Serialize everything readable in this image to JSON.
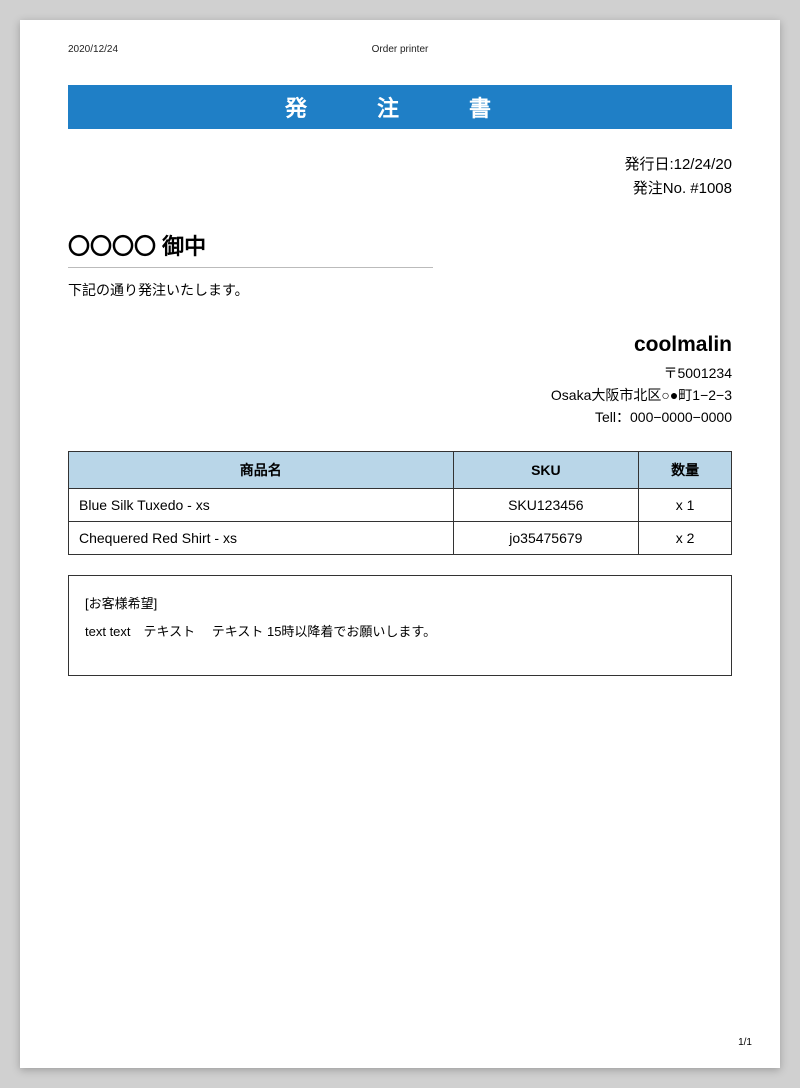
{
  "header": {
    "date_left": "2020/12/24",
    "center": "Order printer"
  },
  "title": "発　注　書",
  "issue": {
    "date_label": "発行日:",
    "date": "12/24/20",
    "no_label": "発注No. ",
    "no": "#1008"
  },
  "recipient": "〇〇〇〇 御中",
  "order_note": "下記の通り発注いたします。",
  "sender": {
    "name": "coolmalin",
    "zip": "〒5001234",
    "address": "Osaka大阪市北区○●町1−2−3",
    "tel": "Tell：000−0000−0000"
  },
  "table": {
    "headers": {
      "name": "商品名",
      "sku": "SKU",
      "qty": "数量"
    },
    "rows": [
      {
        "name": "Blue Silk Tuxedo - xs",
        "sku": "SKU123456",
        "qty": "x 1"
      },
      {
        "name": "Chequered Red Shirt - xs",
        "sku": "jo35475679",
        "qty": "x 2"
      }
    ]
  },
  "customer_note": {
    "label": "[お客様希望]",
    "body": "text text　テキスト　 テキスト 15時以降着でお願いします。"
  },
  "page_num": "1/1"
}
